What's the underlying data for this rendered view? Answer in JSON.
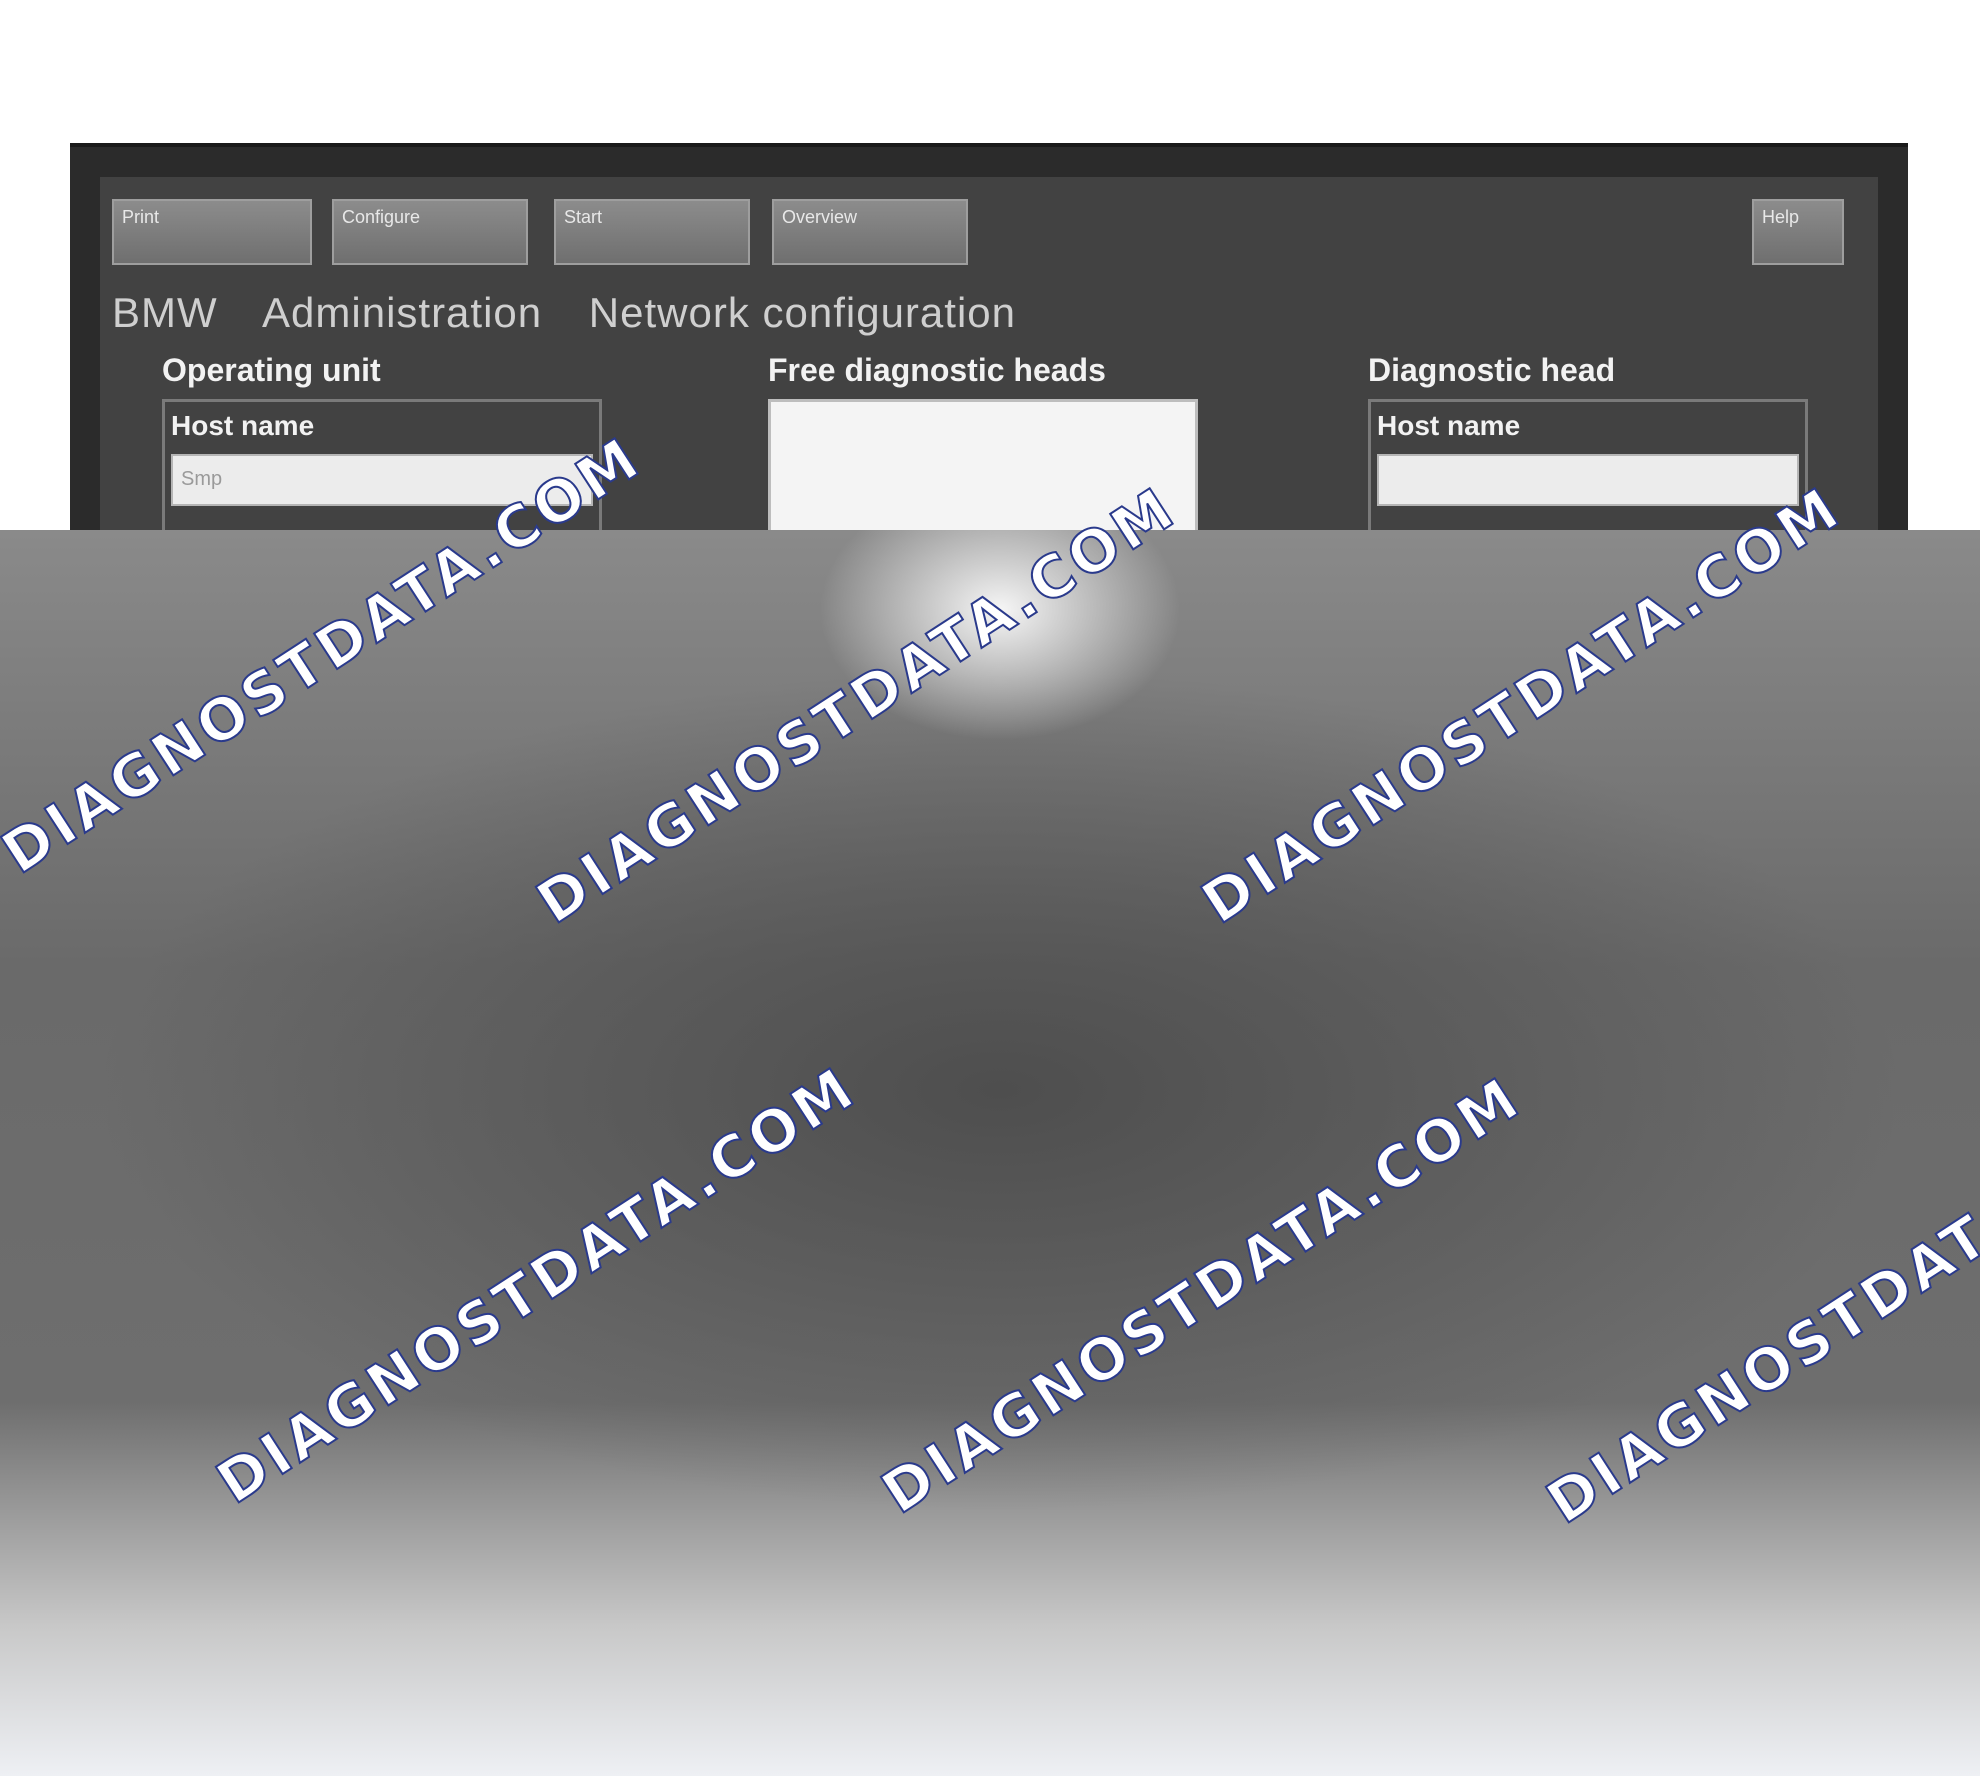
{
  "toolbar": {
    "buttons": [
      "Print",
      "Configure",
      "Start",
      "Overview"
    ],
    "right_button": "Help"
  },
  "header": {
    "brand": "BMW",
    "section": "Administration",
    "page": "Network configuration"
  },
  "operating_unit": {
    "title": "Operating unit",
    "host_name_label": "Host name",
    "host_name_value": "Smp"
  },
  "free_heads": {
    "title": "Free diagnostic heads"
  },
  "diagnostic_head": {
    "title": "Diagnostic head",
    "host_name_label": "Host name",
    "host_name_value": ""
  },
  "watermark": {
    "text": "DIAGNOSTDATA.COM"
  },
  "colors": {
    "screen_bg": "#424242",
    "watermark_outline": "#2a3a8c"
  }
}
